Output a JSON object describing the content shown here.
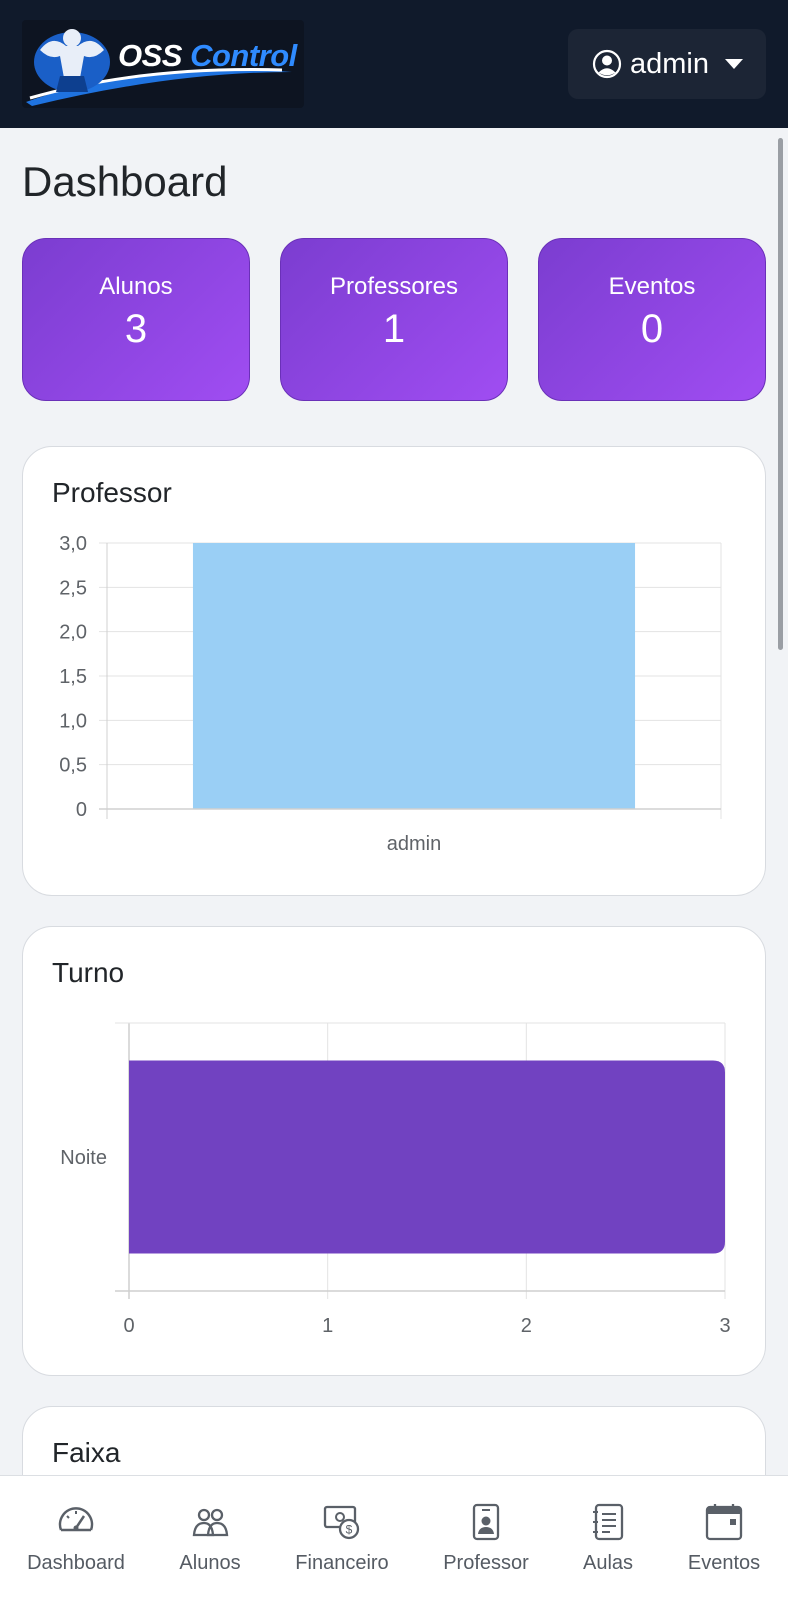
{
  "header": {
    "logo_text_main": "OSS",
    "logo_text_accent": "Control",
    "user_label": "admin",
    "user_icon": "user-circle-icon"
  },
  "page": {
    "title": "Dashboard"
  },
  "stats": [
    {
      "label": "Alunos",
      "value": "3"
    },
    {
      "label": "Professores",
      "value": "1"
    },
    {
      "label": "Eventos",
      "value": "0"
    }
  ],
  "colors": {
    "topbar": "#101a2b",
    "stat_gradient_start": "#7b3dd0",
    "stat_gradient_end": "#a04df2",
    "professor_bar": "#9acff5",
    "turno_bar": "#7142c1"
  },
  "cards": {
    "professor_title": "Professor",
    "turno_title": "Turno",
    "faixa_title": "Faixa"
  },
  "chart_data": [
    {
      "type": "bar",
      "orientation": "vertical",
      "title": "Professor",
      "categories": [
        "admin"
      ],
      "values": [
        3
      ],
      "ylim": [
        0,
        3
      ],
      "yticks": [
        "3,0",
        "2,5",
        "2,0",
        "1,5",
        "1,0",
        "0,5",
        "0"
      ],
      "grid": true,
      "color": "#9acff5"
    },
    {
      "type": "bar",
      "orientation": "horizontal",
      "title": "Turno",
      "categories": [
        "Noite"
      ],
      "values": [
        3
      ],
      "xlim": [
        0,
        3
      ],
      "xticks": [
        "0",
        "1",
        "2",
        "3"
      ],
      "grid": true,
      "color": "#7142c1"
    }
  ],
  "bottom_nav": [
    {
      "label": "Dashboard",
      "icon": "speedometer-icon"
    },
    {
      "label": "Alunos",
      "icon": "people-icon"
    },
    {
      "label": "Financeiro",
      "icon": "cash-icon"
    },
    {
      "label": "Professor",
      "icon": "person-badge-icon"
    },
    {
      "label": "Aulas",
      "icon": "journal-text-icon"
    },
    {
      "label": "Eventos",
      "icon": "calendar-icon"
    }
  ]
}
